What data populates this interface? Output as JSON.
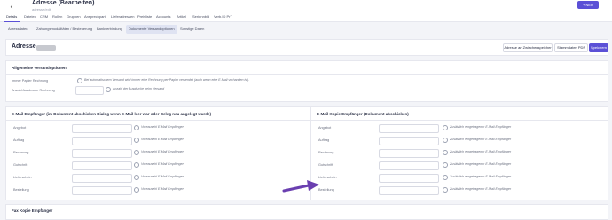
{
  "header": {
    "title": "Adresse (Bearbeiten)",
    "subtitle": "adresse/edit",
    "new_button": "+ NEU"
  },
  "nav": [
    "Details",
    "Dateien",
    "CRM",
    "Rollen",
    "Gruppen",
    "Ansprechpart",
    "Lieferadressen",
    "Preisliste",
    "Accounts",
    "Artikel",
    "Seriennbld",
    "Verb.ID PrT"
  ],
  "tabs": [
    "Adressdaten",
    "Zahlungsmodalitäten / Besteuerung",
    "Bankverbindung",
    "Dokumente Versandoptionen",
    "Sonstige Daten"
  ],
  "title_card": {
    "title": "Adresse",
    "buttons": [
      "Adresse an Zwischenspeicher",
      "Stammdaten PDF",
      "Speichern"
    ]
  },
  "allgemeine": {
    "title": "Allgemeine Versandoptionen",
    "rows": [
      {
        "label": "Immer Papier Rechnung",
        "hint": "Bei automatischem Versand wird immer eine Rechnung per Papier versendet (auch wenn eine E-Mail vorhanden ist)."
      },
      {
        "label": "Anzahl Ausdrucke Rechnung",
        "hint": "Anzahl der Ausdrucke beim Versand"
      }
    ]
  },
  "email_left": {
    "title": "E-Mail Empfänger (im Dokument abschicken Dialog wenn E-Mail leer war oder Beleg neu angelegt wurde)",
    "rows": [
      {
        "label": "Angebot",
        "hint": "Voreausehl E-Mail Empfänger"
      },
      {
        "label": "Auftrag",
        "hint": "Voreausehl E-Mail Empfänger"
      },
      {
        "label": "Rechnung",
        "hint": "Voreausehl E-Mail Empfänger"
      },
      {
        "label": "Gutschrift",
        "hint": "Voreausehl E-Mail Empfänger"
      },
      {
        "label": "Lieferschein",
        "hint": "Voreausehl E-Mail Empfänger"
      },
      {
        "label": "Bestellung",
        "hint": "Voreausehl E-Mail Empfänger"
      }
    ]
  },
  "email_right": {
    "title": "E-Mail Kopie Empfänger (Dokument abschicken)",
    "rows": [
      {
        "label": "Angebot",
        "hint": "Zusätzlich eingetragener E-Mail Empfänger"
      },
      {
        "label": "Auftrag",
        "hint": "Zusätzlich eingetragener E-Mail Empfänger"
      },
      {
        "label": "Rechnung",
        "hint": "Zusätzlich eingetragener E-Mail Empfänger"
      },
      {
        "label": "Gutschrift",
        "hint": "Zusätzlich eingetragener E-Mail Empfänger"
      },
      {
        "label": "Lieferschein",
        "hint": "Zusätzlich eingetragener E-Mail Empfänger"
      },
      {
        "label": "Bestellung",
        "hint": "Zusätzlich eingetragener E-Mail Empfänger"
      }
    ]
  },
  "fax": {
    "title": "Fax Kopie Empfänger"
  },
  "colors": {
    "accent": "#5b50d6",
    "arrow": "#6a3fb0"
  }
}
